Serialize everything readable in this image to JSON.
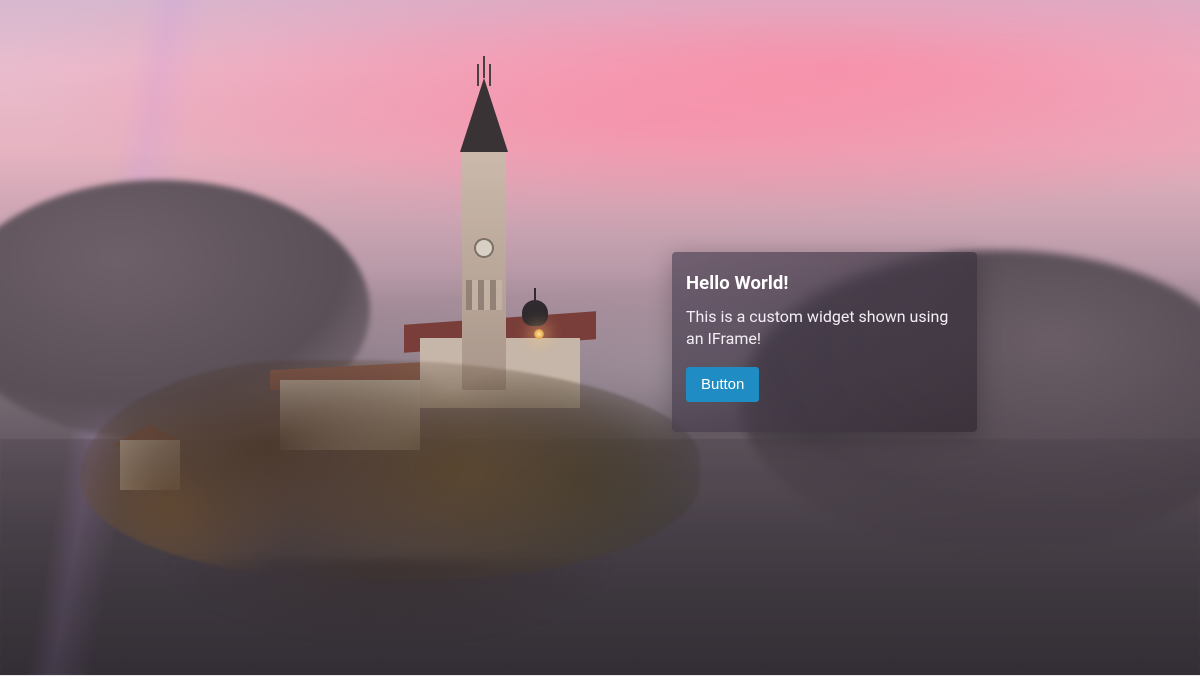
{
  "widget": {
    "title": "Hello World!",
    "body": "This is a custom widget shown using an IFrame!",
    "button_label": "Button"
  },
  "colors": {
    "button_bg": "#1f8dc4",
    "card_text": "#ffffff"
  }
}
